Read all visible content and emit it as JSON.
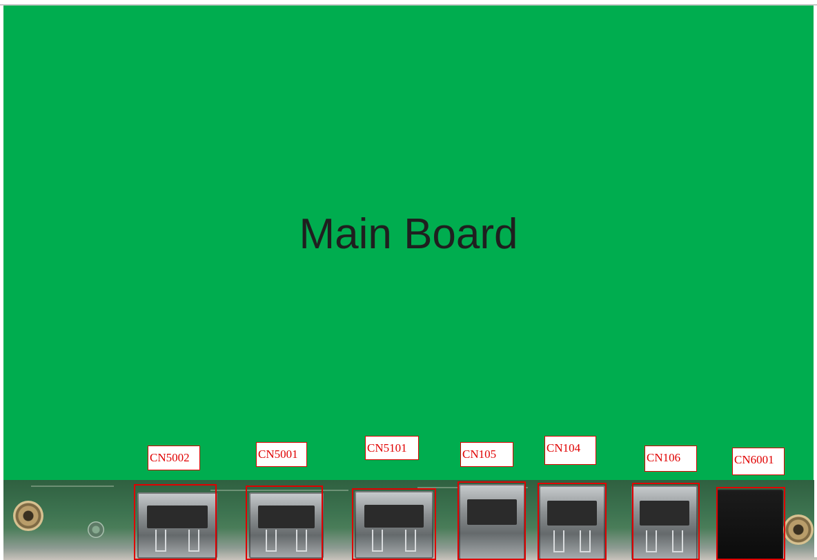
{
  "board": {
    "title": "Main Board",
    "color": "#00ad4f"
  },
  "connectors": [
    {
      "label": "CN5002",
      "kind": "HDMI"
    },
    {
      "label": "CN5001",
      "kind": "HDMI"
    },
    {
      "label": "CN5101",
      "kind": "DisplayPort"
    },
    {
      "label": "CN105",
      "kind": "USB-C"
    },
    {
      "label": "CN104",
      "kind": "USB-A"
    },
    {
      "label": "CN106",
      "kind": "USB-A"
    },
    {
      "label": "CN6001",
      "kind": "Audio jack"
    }
  ],
  "highlight_color": "#e00000"
}
